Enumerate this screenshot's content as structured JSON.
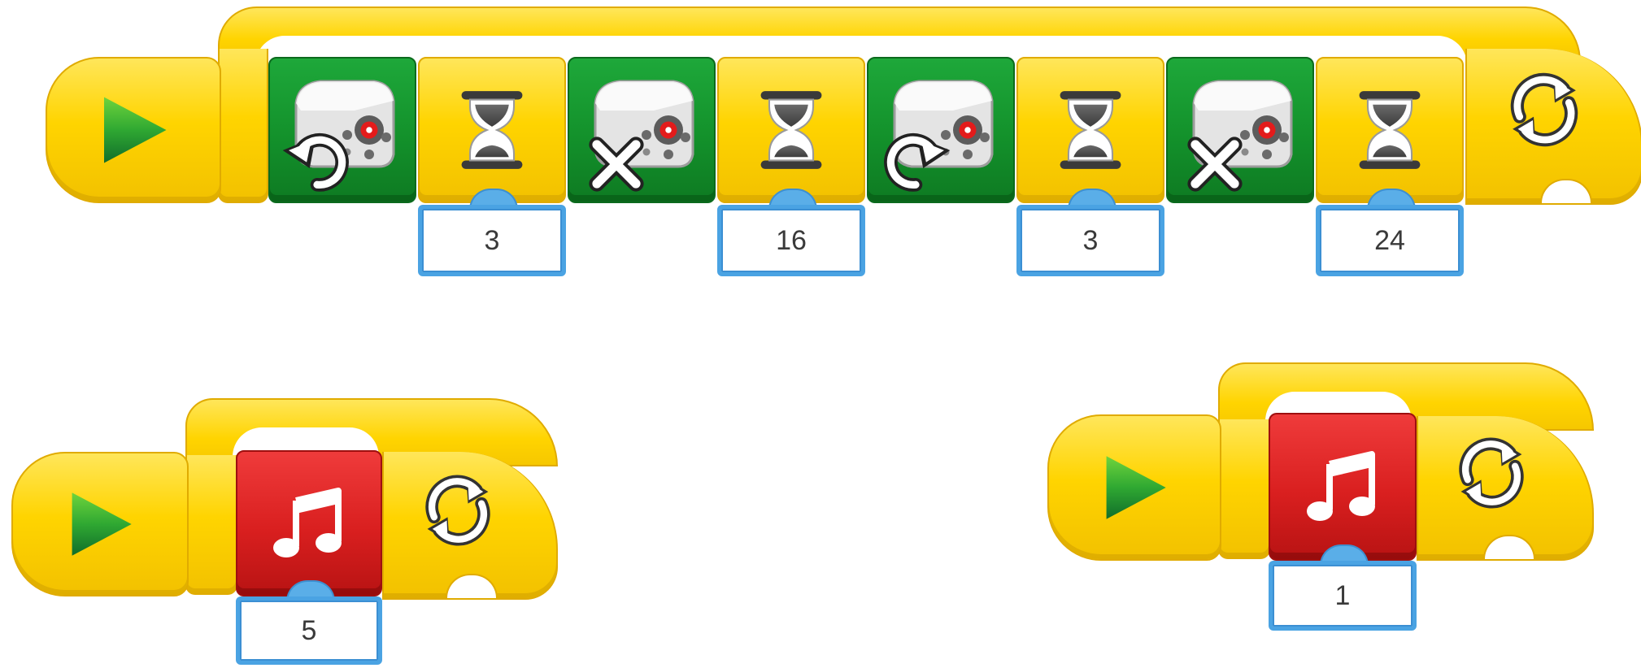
{
  "colors": {
    "flow_yellow": "#ffd400",
    "motor_green": "#13912b",
    "sound_red": "#d91f1f",
    "param_blue": "#4aa3e3"
  },
  "programs": [
    {
      "id": "program-1",
      "start_icon": "play-icon",
      "loop_icon": "repeat-icon",
      "blocks": [
        {
          "type": "motor",
          "icon": "motor-counterclockwise-icon"
        },
        {
          "type": "wait",
          "icon": "hourglass-icon",
          "param": "3"
        },
        {
          "type": "motor",
          "icon": "motor-stop-icon"
        },
        {
          "type": "wait",
          "icon": "hourglass-icon",
          "param": "16"
        },
        {
          "type": "motor",
          "icon": "motor-clockwise-icon"
        },
        {
          "type": "wait",
          "icon": "hourglass-icon",
          "param": "3"
        },
        {
          "type": "motor",
          "icon": "motor-stop-icon"
        },
        {
          "type": "wait",
          "icon": "hourglass-icon",
          "param": "24"
        }
      ]
    },
    {
      "id": "program-2",
      "start_icon": "play-icon",
      "loop_icon": "repeat-icon",
      "blocks": [
        {
          "type": "sound",
          "icon": "music-note-icon",
          "param": "5"
        }
      ]
    },
    {
      "id": "program-3",
      "start_icon": "play-icon",
      "loop_icon": "repeat-icon",
      "blocks": [
        {
          "type": "sound",
          "icon": "music-note-icon",
          "param": "1"
        }
      ]
    }
  ]
}
